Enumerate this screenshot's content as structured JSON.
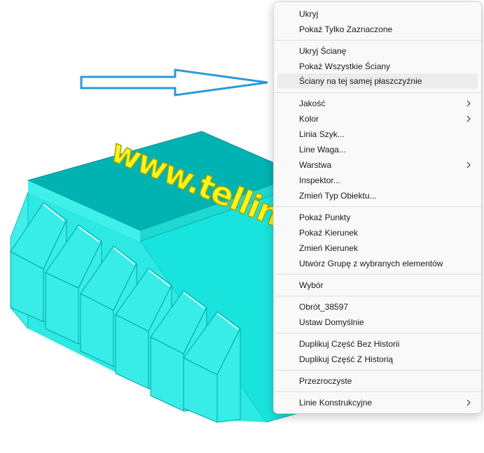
{
  "viewport": {
    "model_text": "www.tellina",
    "model_color": "#2ee8e3",
    "text_color": "#f2f21a",
    "arrow_color": "#2b9ad9"
  },
  "menu": {
    "items": [
      {
        "id": "hide",
        "label": "Ukryj"
      },
      {
        "id": "show-selected-only",
        "label": "Pokaż Tylko Zaznaczone"
      },
      {
        "id": "hide-face",
        "label": "Ukryj Ścianę"
      },
      {
        "id": "show-all-faces",
        "label": "Pokaż Wszystkie Ściany"
      },
      {
        "id": "coplanar-faces",
        "label": "Ściany na tej samej płaszczyźnie",
        "highlighted": true
      },
      {
        "id": "quality",
        "label": "Jakość",
        "submenu": true
      },
      {
        "id": "color",
        "label": "Kolor",
        "submenu": true
      },
      {
        "id": "line-style",
        "label": "Linia Szyk..."
      },
      {
        "id": "line-weight",
        "label": "Line Waga..."
      },
      {
        "id": "layer",
        "label": "Warstwa",
        "submenu": true
      },
      {
        "id": "inspector",
        "label": "Inspektor..."
      },
      {
        "id": "change-object-type",
        "label": "Zmień Typ Obiektu..."
      },
      {
        "id": "show-points",
        "label": "Pokaż Punkty"
      },
      {
        "id": "show-direction",
        "label": "Pokaż Kierunek"
      },
      {
        "id": "change-direction",
        "label": "Zmień Kierunek"
      },
      {
        "id": "create-group",
        "label": "Utwórz Grupę z wybranych elementów"
      },
      {
        "id": "selection",
        "label": "Wybór"
      },
      {
        "id": "rotation",
        "label": "Obrót_38597"
      },
      {
        "id": "set-default",
        "label": "Ustaw Domyślnie"
      },
      {
        "id": "duplicate-no-history",
        "label": "Duplikuj Część Bez Historii"
      },
      {
        "id": "duplicate-with-history",
        "label": "Duplikuj Część Z Historią"
      },
      {
        "id": "transparent",
        "label": "Przezroczyste"
      },
      {
        "id": "construction-lines",
        "label": "Linie Konstrukcyjne",
        "submenu": true
      }
    ]
  }
}
